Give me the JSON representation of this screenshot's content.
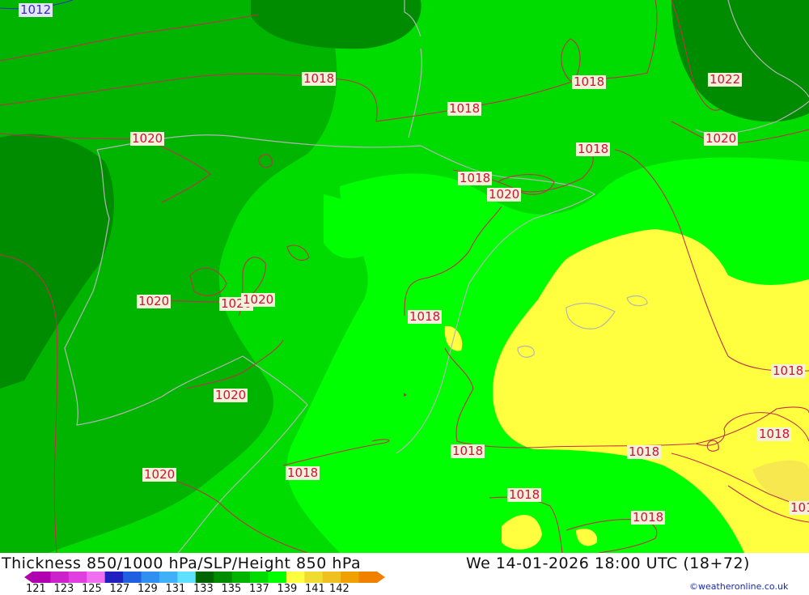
{
  "isobar_labels": [
    {
      "text": "1012",
      "color": "blue"
    },
    {
      "text": "1018"
    },
    {
      "text": "1018"
    },
    {
      "text": "1018"
    },
    {
      "text": "1022"
    },
    {
      "text": "1020"
    },
    {
      "text": "1018"
    },
    {
      "text": "1020"
    },
    {
      "text": "1018"
    },
    {
      "text": "1020"
    },
    {
      "text": "1020"
    },
    {
      "text": "1020"
    },
    {
      "text": "1020"
    },
    {
      "text": "1018"
    },
    {
      "text": "1020"
    },
    {
      "text": "1018"
    },
    {
      "text": "1018"
    },
    {
      "text": "1020"
    },
    {
      "text": "1018"
    },
    {
      "text": "1018"
    },
    {
      "text": "1018"
    },
    {
      "text": "1018"
    },
    {
      "text": "1018"
    },
    {
      "text": "101"
    }
  ],
  "footer": {
    "title": "Thickness 850/1000 hPa/SLP/Height 850 hPa",
    "datetime": "We 14-01-2026 18:00 UTC (18+72)",
    "credit": "©weatheronline.co.uk"
  },
  "legend": {
    "colors": [
      "#b000b0",
      "#cc22cc",
      "#e040e0",
      "#f070f0",
      "#2020c0",
      "#2060e0",
      "#3090f0",
      "#40b0f8",
      "#60e0ff",
      "#006400",
      "#008c00",
      "#00b400",
      "#00dc00",
      "#00ff00",
      "#ffff40",
      "#f0dc30",
      "#f0c020",
      "#f0a000",
      "#f08000"
    ],
    "ticks": [
      "121",
      "123",
      "125",
      "127",
      "129",
      "131",
      "133",
      "135",
      "137",
      "139",
      "141",
      "142"
    ]
  },
  "colors": {
    "isobar": "#c0304a",
    "coastline": "#b4b4b4",
    "thick_dark": "#008c00",
    "thick_mid": "#00b400",
    "thick_light": "#00dc00",
    "thick_bright": "#00ff00",
    "thick_yellow": "#ffff40"
  }
}
